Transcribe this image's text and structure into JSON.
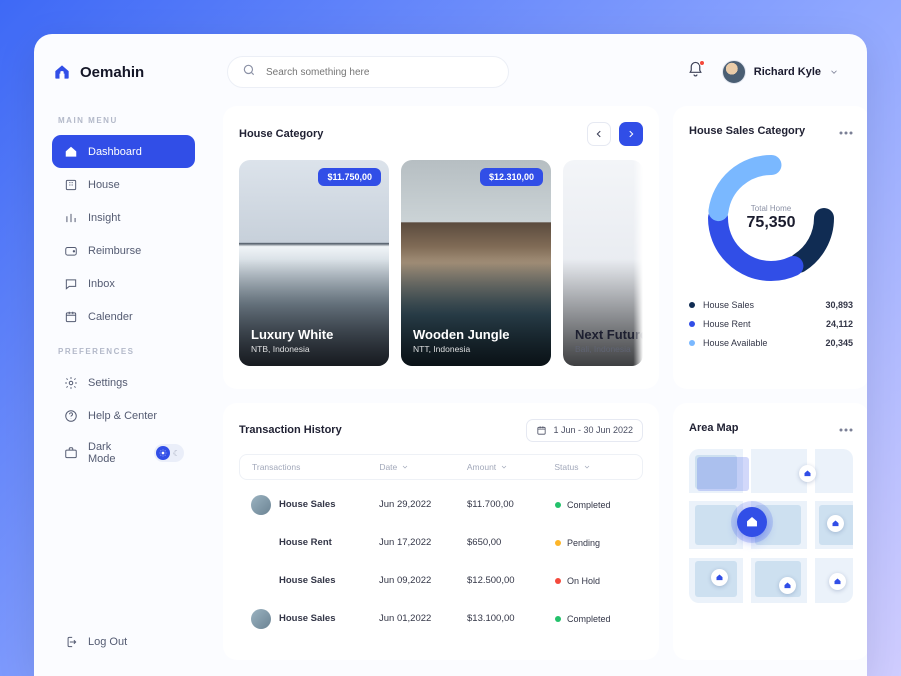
{
  "app": {
    "name": "Oemahin"
  },
  "search": {
    "placeholder": "Search something here"
  },
  "user": {
    "name": "Richard Kyle"
  },
  "sidebar": {
    "group_main_label": "MAIN MENU",
    "group_prefs_label": "PREFERENCES",
    "items_main": [
      {
        "label": "Dashboard"
      },
      {
        "label": "House"
      },
      {
        "label": "Insight"
      },
      {
        "label": "Reimburse"
      },
      {
        "label": "Inbox"
      },
      {
        "label": "Calender"
      }
    ],
    "items_prefs": [
      {
        "label": "Settings"
      },
      {
        "label": "Help & Center"
      }
    ],
    "darkmode_label": "Dark Mode",
    "logout_label": "Log Out"
  },
  "house_category": {
    "title": "House Category",
    "cards": [
      {
        "price": "$11.750,00",
        "title": "Luxury White",
        "sub": "NTB, Indonesia"
      },
      {
        "price": "$12.310,00",
        "title": "Wooden Jungle",
        "sub": "NTT, Indonesia"
      },
      {
        "title": "Next Future",
        "sub": "Bali, Indonesia"
      }
    ]
  },
  "sales_category": {
    "title": "House Sales Category",
    "center_label": "Total Home",
    "center_value": "75,350",
    "legend": [
      {
        "label": "House Sales",
        "value": "30,893",
        "color": "#102C53"
      },
      {
        "label": "House Rent",
        "value": "24,112",
        "color": "#314EE7"
      },
      {
        "label": "House Available",
        "value": "20,345",
        "color": "#7AB8FF"
      }
    ]
  },
  "chart_data": {
    "type": "pie",
    "title": "House Sales Category",
    "series": [
      {
        "name": "House Sales",
        "value": 30893
      },
      {
        "name": "House Rent",
        "value": 24112
      },
      {
        "name": "House Available",
        "value": 20345
      }
    ],
    "total_label": "Total Home",
    "total_value": 75350
  },
  "transactions": {
    "title": "Transaction History",
    "date_range": "1 Jun - 30 Jun 2022",
    "headers": {
      "trans": "Transactions",
      "date": "Date",
      "amount": "Amount",
      "status": "Status"
    },
    "rows": [
      {
        "title": "House Sales",
        "date": "Jun 29,2022",
        "amount": "$11.700,00",
        "status": "Completed",
        "status_color": "#23C16B",
        "avatar": true
      },
      {
        "title": "House Rent",
        "date": "Jun 17,2022",
        "amount": "$650,00",
        "status": "Pending",
        "status_color": "#FDB528",
        "avatar": false
      },
      {
        "title": "House Sales",
        "date": "Jun 09,2022",
        "amount": "$12.500,00",
        "status": "On Hold",
        "status_color": "#F4493C",
        "avatar": false
      },
      {
        "title": "House Sales",
        "date": "Jun 01,2022",
        "amount": "$13.100,00",
        "status": "Completed",
        "status_color": "#23C16B",
        "avatar": true
      }
    ]
  },
  "area_map": {
    "title": "Area Map"
  }
}
